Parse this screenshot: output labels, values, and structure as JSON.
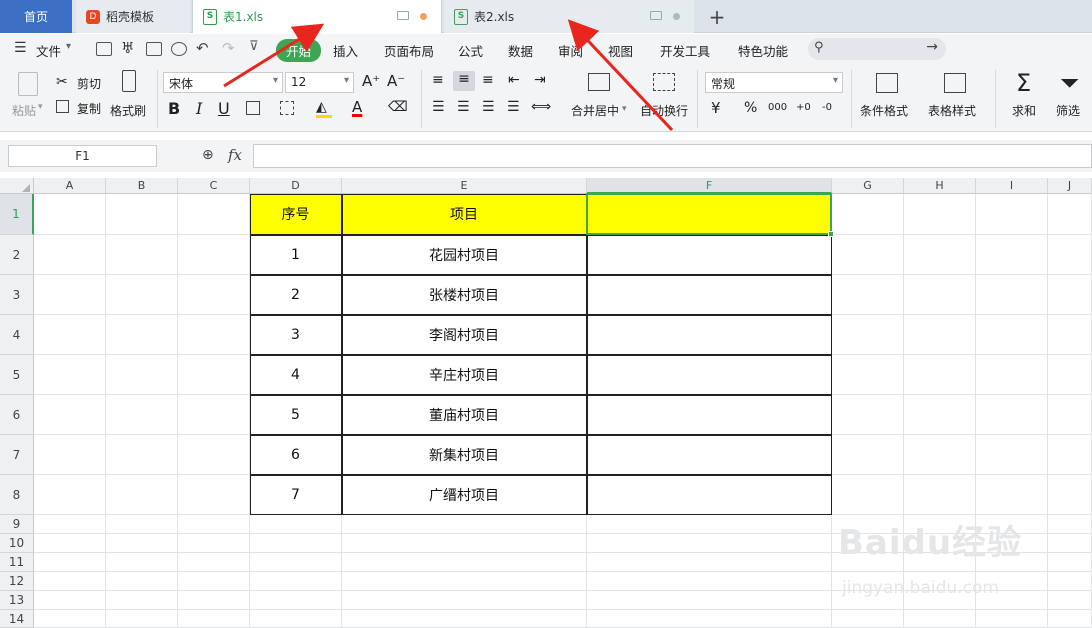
{
  "tabs": {
    "home": "首页",
    "template": "稻壳模板",
    "tpl_badge": "D",
    "file1": "表1.xls",
    "file2": "表2.xls",
    "add": "+",
    "doc_badge": "S"
  },
  "menu": {
    "file": "文件",
    "items": [
      "开始",
      "插入",
      "页面布局",
      "公式",
      "数据",
      "审阅",
      "视图",
      "开发工具",
      "特色功能"
    ]
  },
  "ribbon": {
    "paste": "粘贴",
    "cut": "剪切",
    "copy": "复制",
    "format_painter": "格式刷",
    "font_name": "宋体",
    "font_size": "12",
    "grow": "A⁺",
    "shrink": "A⁻",
    "bold": "B",
    "italic": "I",
    "underline": "U",
    "font_color": "A",
    "merge": "合并居中",
    "wrap": "自动换行",
    "number_format": "常规",
    "currency": "¥",
    "percent": "%",
    "thousands": "000",
    "inc_dec": "+0",
    "dec_dec": "-0",
    "cond_format": "条件格式",
    "table_style": "表格样式",
    "sum": "求和",
    "filter": "筛选",
    "sum_icon": "Σ"
  },
  "formula_bar": {
    "cell_ref": "F1",
    "fx": "fx",
    "value": ""
  },
  "sheet": {
    "columns": [
      "A",
      "B",
      "C",
      "D",
      "E",
      "F",
      "G",
      "H",
      "I",
      "J"
    ],
    "rows": [
      "1",
      "2",
      "3",
      "4",
      "5",
      "6",
      "7",
      "8",
      "9",
      "10",
      "11",
      "12",
      "13",
      "14"
    ],
    "header": [
      "序号",
      "项目",
      ""
    ],
    "data": [
      [
        "1",
        "花园村项目",
        ""
      ],
      [
        "2",
        "张楼村项目",
        ""
      ],
      [
        "3",
        "李阁村项目",
        ""
      ],
      [
        "4",
        "辛庄村项目",
        ""
      ],
      [
        "5",
        "董庙村项目",
        ""
      ],
      [
        "6",
        "新集村项目",
        ""
      ],
      [
        "7",
        "广缙村项目",
        ""
      ]
    ]
  },
  "colors": {
    "header_fill": "#ffff00",
    "selection": "#3fa555",
    "arrow": "#e8261f",
    "home_tab": "#3a6fc4",
    "tab1_dot": "#f0a060",
    "tab2_dot": "#b0b8c0"
  },
  "watermark": {
    "brand": "Baidu经验",
    "url": "jingyan.baidu.com"
  }
}
